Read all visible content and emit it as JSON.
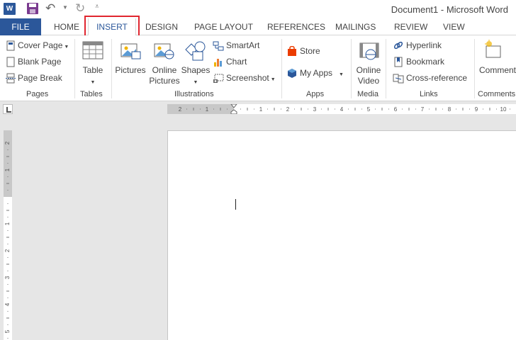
{
  "titlebar": {
    "app_icon_letter": "W",
    "window_title": "Document1 - Microsoft Word"
  },
  "tabs": {
    "file": "FILE",
    "items": [
      "HOME",
      "INSERT",
      "DESIGN",
      "PAGE LAYOUT",
      "REFERENCES",
      "MAILINGS",
      "REVIEW",
      "VIEW"
    ],
    "active": "INSERT"
  },
  "ribbon": {
    "pages": {
      "label": "Pages",
      "cover_page": "Cover Page",
      "blank_page": "Blank Page",
      "page_break": "Page Break"
    },
    "tables": {
      "label": "Tables",
      "table": "Table"
    },
    "illustrations": {
      "label": "Illustrations",
      "pictures": "Pictures",
      "online_pictures_1": "Online",
      "online_pictures_2": "Pictures",
      "shapes": "Shapes",
      "smartart": "SmartArt",
      "chart": "Chart",
      "screenshot": "Screenshot"
    },
    "apps": {
      "label": "Apps",
      "store": "Store",
      "my_apps": "My Apps"
    },
    "media": {
      "label": "Media",
      "online_video_1": "Online",
      "online_video_2": "Video"
    },
    "links": {
      "label": "Links",
      "hyperlink": "Hyperlink",
      "bookmark": "Bookmark",
      "cross_reference": "Cross-reference"
    },
    "comments": {
      "label": "Comments",
      "comment": "Comment"
    }
  },
  "ruler": {
    "h_left_ticks": [
      "2",
      "1"
    ],
    "h_right_ticks": [
      "1",
      "2",
      "3",
      "4",
      "5",
      "6",
      "7",
      "8",
      "9",
      "10"
    ],
    "v_top_ticks": [
      "2",
      "1"
    ],
    "v_bottom_ticks": [
      "1",
      "2",
      "3",
      "4",
      "5"
    ]
  },
  "colors": {
    "word_blue": "#2b579a",
    "highlight_red": "#e0262f",
    "store_orange": "#eb3c00"
  }
}
